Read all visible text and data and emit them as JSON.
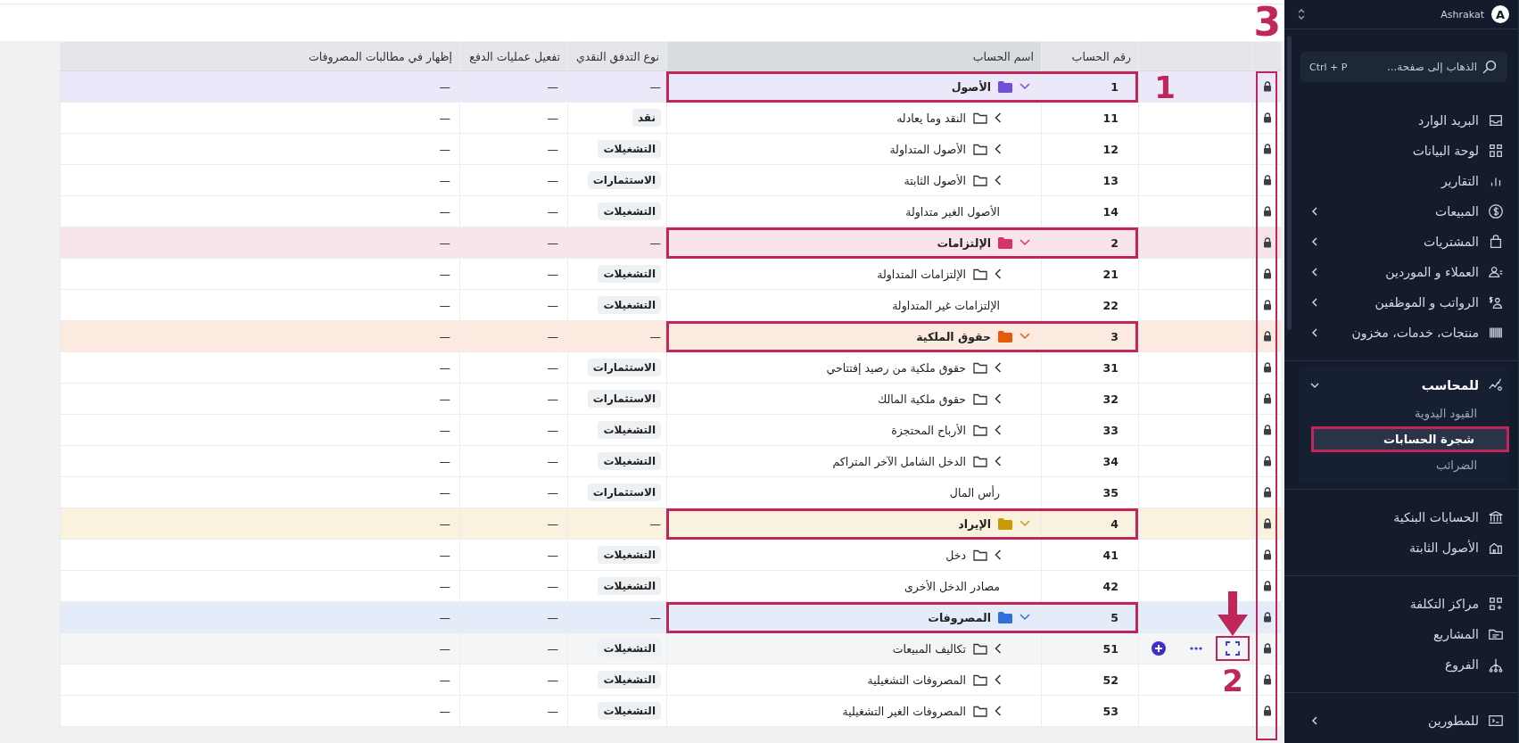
{
  "table": {
    "columns": [
      "رقم الحساب",
      "اسم الحساب",
      "نوع التدفق النقدي",
      "تفعيل عمليات الدفع",
      "إظهار في مطالبات المصروفات"
    ],
    "lock_column_outlined": true,
    "lock_column_callout": "3",
    "rows": [
      {
        "number": "1",
        "name": "الأصول",
        "kind": "parent",
        "color": "#6d4fd8",
        "outlined": true,
        "callout": "1",
        "hovered": false,
        "cash_flow": "—",
        "payment": "—",
        "expense_claims": "—"
      },
      {
        "number": "11",
        "name": "النقد وما يعادله",
        "kind": "group",
        "outlined": false,
        "hovered": false,
        "cash_flow": "نقد",
        "payment": "—",
        "expense_claims": "—"
      },
      {
        "number": "12",
        "name": "الأصول المتداولة",
        "kind": "group",
        "outlined": false,
        "hovered": false,
        "cash_flow": "التشغيلات",
        "payment": "—",
        "expense_claims": "—"
      },
      {
        "number": "13",
        "name": "الأصول الثابتة",
        "kind": "group",
        "outlined": false,
        "hovered": false,
        "cash_flow": "الاستثمارات",
        "payment": "—",
        "expense_claims": "—"
      },
      {
        "number": "14",
        "name": "الأصول الغير متداولة",
        "kind": "leaf",
        "outlined": false,
        "hovered": false,
        "cash_flow": "التشغيلات",
        "payment": "—",
        "expense_claims": "—"
      },
      {
        "number": "2",
        "name": "الإلتزامات",
        "kind": "parent",
        "color": "#d6336c",
        "outlined": true,
        "hovered": false,
        "cash_flow": "—",
        "payment": "—",
        "expense_claims": "—"
      },
      {
        "number": "21",
        "name": "الإلتزامات المتداولة",
        "kind": "group",
        "outlined": false,
        "hovered": false,
        "cash_flow": "التشغيلات",
        "payment": "—",
        "expense_claims": "—"
      },
      {
        "number": "22",
        "name": "الإلتزامات غير المتداولة",
        "kind": "leaf",
        "outlined": false,
        "hovered": false,
        "cash_flow": "التشغيلات",
        "payment": "—",
        "expense_claims": "—"
      },
      {
        "number": "3",
        "name": "حقوق الملكية",
        "kind": "parent",
        "color": "#e8590c",
        "outlined": true,
        "hovered": false,
        "cash_flow": "—",
        "payment": "—",
        "expense_claims": "—"
      },
      {
        "number": "31",
        "name": "حقوق ملكية من رصيد إفتتاحي",
        "kind": "group",
        "outlined": false,
        "hovered": false,
        "cash_flow": "الاستثمارات",
        "payment": "—",
        "expense_claims": "—"
      },
      {
        "number": "32",
        "name": "حقوق ملكية المالك",
        "kind": "group",
        "outlined": false,
        "hovered": false,
        "cash_flow": "الاستثمارات",
        "payment": "—",
        "expense_claims": "—"
      },
      {
        "number": "33",
        "name": "الأرباح المحتجزة",
        "kind": "group",
        "outlined": false,
        "hovered": false,
        "cash_flow": "التشغيلات",
        "payment": "—",
        "expense_claims": "—"
      },
      {
        "number": "34",
        "name": "الدخل الشامل الآخر المتراكم",
        "kind": "group",
        "outlined": false,
        "hovered": false,
        "cash_flow": "التشغيلات",
        "payment": "—",
        "expense_claims": "—"
      },
      {
        "number": "35",
        "name": "رأس المال",
        "kind": "leaf",
        "outlined": false,
        "hovered": false,
        "cash_flow": "الاستثمارات",
        "payment": "—",
        "expense_claims": "—"
      },
      {
        "number": "4",
        "name": "الإيراد",
        "kind": "parent",
        "color": "#c99a06",
        "outlined": true,
        "hovered": false,
        "cash_flow": "—",
        "payment": "—",
        "expense_claims": "—"
      },
      {
        "number": "41",
        "name": "دخل",
        "kind": "group",
        "outlined": false,
        "hovered": false,
        "cash_flow": "التشغيلات",
        "payment": "—",
        "expense_claims": "—"
      },
      {
        "number": "42",
        "name": "مصادر الدخل الأخرى",
        "kind": "leaf",
        "outlined": false,
        "hovered": false,
        "cash_flow": "التشغيلات",
        "payment": "—",
        "expense_claims": "—"
      },
      {
        "number": "5",
        "name": "المصروفات",
        "kind": "parent",
        "color": "#2f6fdb",
        "outlined": true,
        "hovered": false,
        "cash_flow": "—",
        "payment": "—",
        "expense_claims": "—"
      },
      {
        "number": "51",
        "name": "تكاليف المبيعات",
        "kind": "group",
        "outlined": false,
        "hovered": true,
        "expand_outlined": true,
        "callout": "2",
        "cash_flow": "التشغيلات",
        "payment": "—",
        "expense_claims": "—"
      },
      {
        "number": "52",
        "name": "المصروفات التشغيلية",
        "kind": "group",
        "outlined": false,
        "hovered": false,
        "cash_flow": "التشغيلات",
        "payment": "—",
        "expense_claims": "—"
      },
      {
        "number": "53",
        "name": "المصروفات الغير التشغيلية",
        "kind": "group",
        "outlined": false,
        "hovered": false,
        "cash_flow": "التشغيلات",
        "payment": "—",
        "expense_claims": "—"
      }
    ]
  },
  "sidebar": {
    "user": {
      "name": "Ashrakat",
      "initial": "A"
    },
    "search": {
      "placeholder": "الذهاب إلى صفحة...",
      "shortcut": "Ctrl + P"
    },
    "groups": [
      [
        {
          "label": "البريد الوارد",
          "has_submenu": false
        },
        {
          "label": "لوحة البيانات",
          "has_submenu": false
        },
        {
          "label": "التقارير",
          "has_submenu": false
        },
        {
          "label": "المبيعات",
          "has_submenu": true,
          "expanded": false
        },
        {
          "label": "المشتريات",
          "has_submenu": true,
          "expanded": false
        },
        {
          "label": "العملاء و الموردين",
          "has_submenu": true,
          "expanded": false
        },
        {
          "label": "الرواتب و الموظفين",
          "has_submenu": true,
          "expanded": false
        },
        {
          "label": "منتجات، خدمات، مخزون",
          "has_submenu": true,
          "expanded": false
        }
      ],
      [
        {
          "label": "للمحاسب",
          "has_submenu": true,
          "expanded": true,
          "children": [
            {
              "label": "القيود اليدوية",
              "selected": false,
              "outlined": false
            },
            {
              "label": "شجرة الحسابات",
              "selected": true,
              "outlined": true
            },
            {
              "label": "الضرائب",
              "selected": false,
              "outlined": false
            }
          ]
        }
      ],
      [
        {
          "label": "الحسابات البنكية",
          "has_submenu": false
        },
        {
          "label": "الأصول الثابتة",
          "has_submenu": false
        }
      ],
      [
        {
          "label": "مراكز التكلفة",
          "has_submenu": false
        },
        {
          "label": "المشاريع",
          "has_submenu": false
        },
        {
          "label": "الفروع",
          "has_submenu": false
        }
      ],
      [
        {
          "label": "للمطورين",
          "has_submenu": true,
          "expanded": false
        }
      ]
    ]
  }
}
